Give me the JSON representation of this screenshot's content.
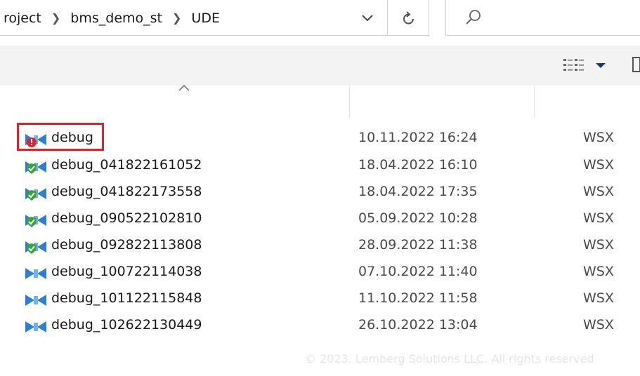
{
  "address_bar": {
    "crumbs": [
      "roject",
      "bms_demo_st",
      "UDE"
    ]
  },
  "files": [
    {
      "name": "debug",
      "date": "10.11.2022 16:24",
      "type": "WSX",
      "icon": "wsx-error-icon"
    },
    {
      "name": "debug_041822161052",
      "date": "18.04.2022 16:10",
      "type": "WSX",
      "icon": "wsx-verified-icon"
    },
    {
      "name": "debug_041822173558",
      "date": "18.04.2022 17:35",
      "type": "WSX",
      "icon": "wsx-verified-icon"
    },
    {
      "name": "debug_090522102810",
      "date": "05.09.2022 10:28",
      "type": "WSX",
      "icon": "wsx-verified-icon"
    },
    {
      "name": "debug_092822113808",
      "date": "28.09.2022 11:38",
      "type": "WSX",
      "icon": "wsx-verified-icon"
    },
    {
      "name": "debug_100722114038",
      "date": "07.10.2022 11:40",
      "type": "WSX",
      "icon": "wsx-file-icon"
    },
    {
      "name": "debug_101122115848",
      "date": "11.10.2022 11:58",
      "type": "WSX",
      "icon": "wsx-file-icon"
    },
    {
      "name": "debug_102622130449",
      "date": "26.10.2022 13:04",
      "type": "WSX",
      "icon": "wsx-file-icon"
    }
  ],
  "colors": {
    "highlight": "#e0202a",
    "icon_blue": "#2d7fd3",
    "icon_green": "#3aa13a",
    "icon_red": "#d9262c"
  },
  "watermark": "© 2023. Lemberg Solutions LLC. All rights reserved"
}
